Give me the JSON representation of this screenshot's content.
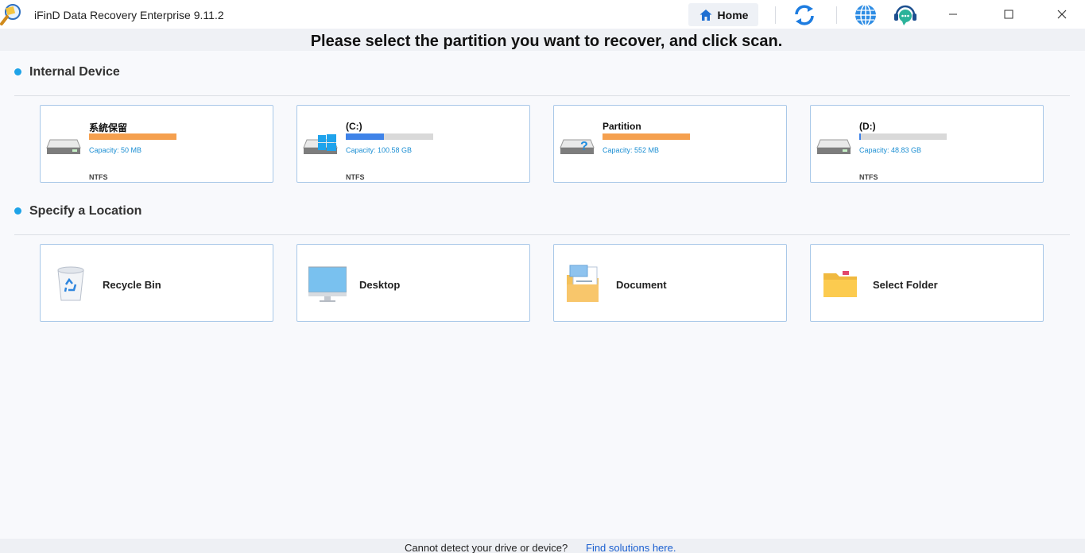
{
  "app": {
    "title": "iFinD Data Recovery Enterprise 9.11.2",
    "logo_icon": "magnifier-logo-icon"
  },
  "toolbar": {
    "home_label": "Home",
    "icons": [
      "refresh-icon",
      "globe-icon",
      "support-chat-icon"
    ],
    "window_controls": [
      "minimize-icon",
      "maximize-icon",
      "close-icon"
    ]
  },
  "heading": "Please select the partition you want to recover, and click scan.",
  "internal_device": {
    "title": "Internal Device",
    "drives": [
      {
        "name": "系統保留",
        "capacity": "Capacity: 50 MB",
        "filesystem": "NTFS",
        "usage": 1.0,
        "bar_color": "#f5a04e",
        "icon": "hard-drive-icon"
      },
      {
        "name": "(C:)",
        "capacity": "Capacity: 100.58 GB",
        "filesystem": "NTFS",
        "usage": 0.44,
        "bar_color": "#3f83e8",
        "icon": "windows-drive-icon"
      },
      {
        "name": "Partition",
        "capacity": "Capacity: 552 MB",
        "filesystem": "",
        "usage": 1.0,
        "bar_color": "#f5a04e",
        "icon": "unknown-drive-icon"
      },
      {
        "name": "(D:)",
        "capacity": "Capacity: 48.83 GB",
        "filesystem": "NTFS",
        "usage": 0.02,
        "bar_color": "#3f83e8",
        "icon": "hard-drive-icon"
      }
    ]
  },
  "specify_location": {
    "title": "Specify a Location",
    "locations": [
      {
        "label": "Recycle Bin",
        "icon": "recycle-bin-icon"
      },
      {
        "label": "Desktop",
        "icon": "desktop-monitor-icon"
      },
      {
        "label": "Document",
        "icon": "document-folder-icon"
      },
      {
        "label": "Select Folder",
        "icon": "folder-icon"
      }
    ]
  },
  "footer": {
    "text": "Cannot detect your drive or device?",
    "link": "Find solutions here."
  },
  "colors": {
    "accent": "#1ea3e8",
    "card_border": "#a9c8e8",
    "link": "#1a5fd0",
    "orange_bar": "#f5a04e",
    "blue_bar": "#3f83e8"
  }
}
